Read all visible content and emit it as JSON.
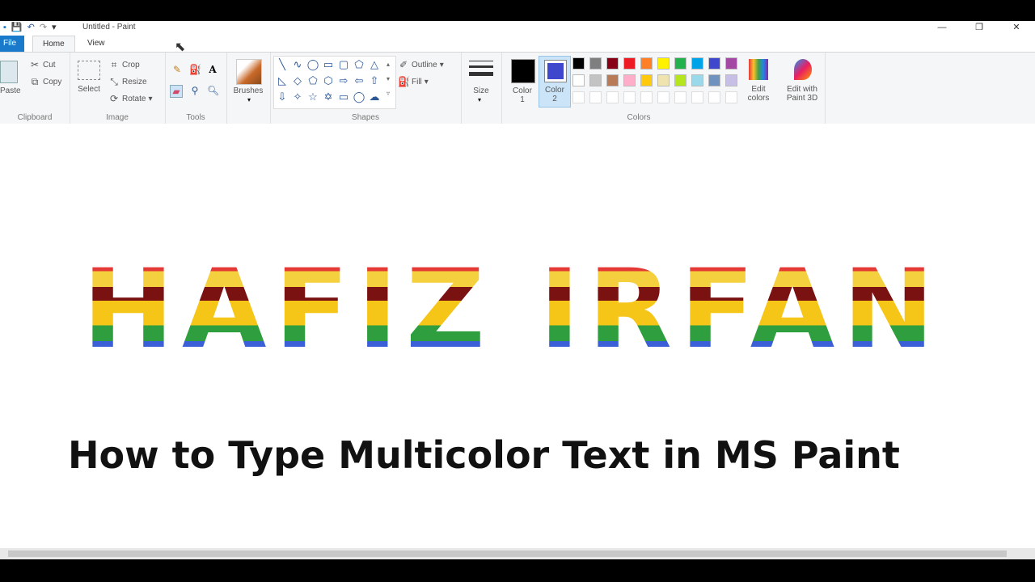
{
  "window": {
    "title": "Untitled - Paint"
  },
  "tabs": [
    {
      "label": "File"
    },
    {
      "label": "Home"
    },
    {
      "label": "View"
    }
  ],
  "clipboard": {
    "paste": "Paste",
    "cut": "Cut",
    "copy": "Copy",
    "group": "Clipboard"
  },
  "image": {
    "select": "Select",
    "crop": "Crop",
    "resize": "Resize",
    "rotate": "Rotate",
    "group": "Image"
  },
  "tools": {
    "group": "Tools",
    "brushes": "Brushes"
  },
  "shapes": {
    "outline": "Outline",
    "fill": "Fill",
    "group": "Shapes"
  },
  "size": {
    "label": "Size"
  },
  "colors": {
    "color1": "Color\n1",
    "color2": "Color\n2",
    "edit_colors": "Edit\ncolors",
    "edit_paint3d": "Edit with\nPaint 3D",
    "group": "Colors",
    "color1_value": "#000000",
    "color2_value": "#3f48cc",
    "palette_row1": [
      "#000000",
      "#7f7f7f",
      "#880015",
      "#ed1c24",
      "#ff7f27",
      "#fff200",
      "#22b14c",
      "#00a2e8",
      "#3f48cc",
      "#a349a4"
    ],
    "palette_row2": [
      "#ffffff",
      "#c3c3c3",
      "#b97a57",
      "#ffaec9",
      "#ffc90e",
      "#efe4b0",
      "#b5e61d",
      "#99d9ea",
      "#7092be",
      "#c8bfe7"
    ]
  },
  "canvas": {
    "art_text": "HAFIZ IRFAN",
    "caption": "How to Type Multicolor Text in MS Paint"
  }
}
